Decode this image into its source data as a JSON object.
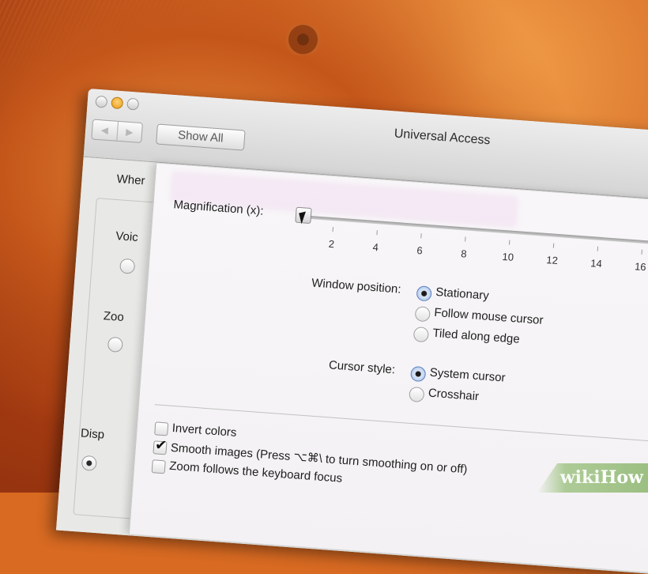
{
  "window": {
    "title": "Universal Access",
    "show_all": "Show All",
    "nav_back": "◀",
    "nav_forward": "▶"
  },
  "background_pane": {
    "header_fragment": "Wher",
    "voice_fragment": "Voic",
    "zoom_fragment": "Zoo",
    "display_fragment": "Disp"
  },
  "sheet": {
    "magnification_label": "Magnification (x):",
    "ticks": [
      "2",
      "4",
      "6",
      "8",
      "10",
      "12",
      "14",
      "16"
    ],
    "window_position_label": "Window position:",
    "window_position_options": [
      "Stationary",
      "Follow mouse cursor",
      "Tiled along edge"
    ],
    "window_position_selected": "Stationary",
    "cursor_style_label": "Cursor style:",
    "cursor_style_options": [
      "System cursor",
      "Crosshair"
    ],
    "cursor_style_selected": "System cursor",
    "checkboxes": [
      {
        "label": "Invert colors",
        "checked": false
      },
      {
        "label": "Smooth images (Press ⌥⌘\\ to turn smoothing on or off)",
        "checked": true
      },
      {
        "label": "Zoom follows the keyboard focus",
        "checked": false
      }
    ]
  },
  "watermark": {
    "part1": "wiki",
    "part2": "How"
  }
}
